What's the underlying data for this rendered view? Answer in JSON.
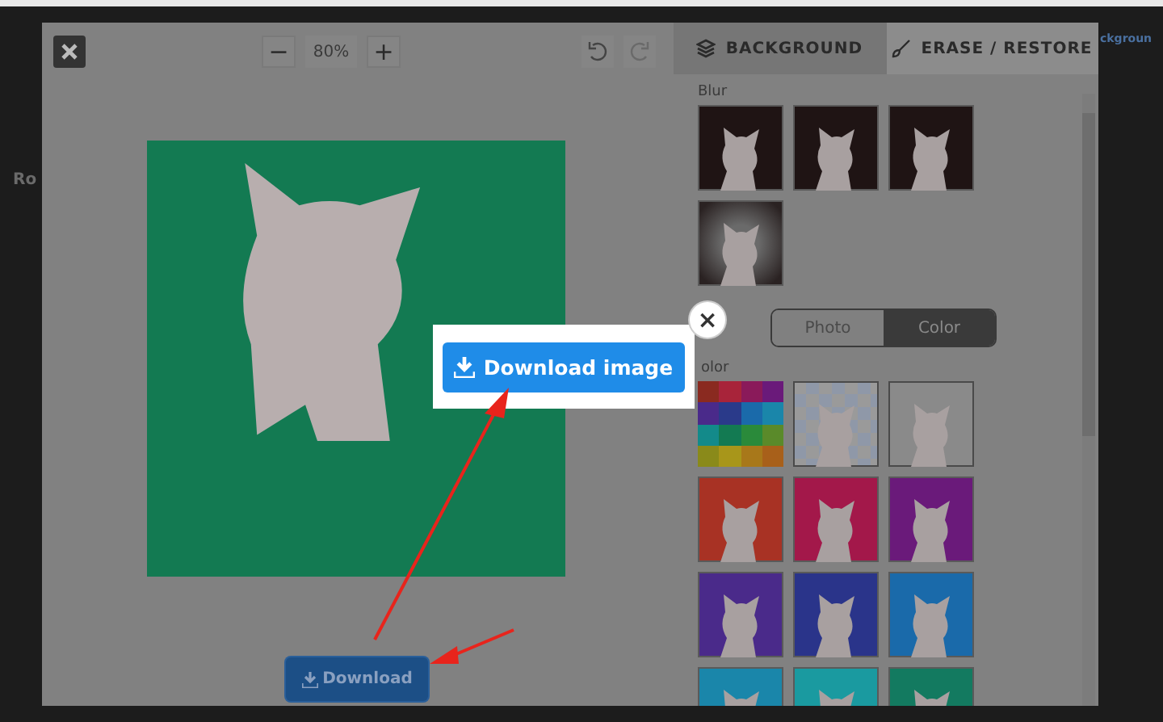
{
  "page_behind": {
    "left_text": "Ro",
    "right_text": "ckgroun"
  },
  "editor": {
    "zoom_out": "−",
    "zoom": "80%",
    "zoom_in": "+",
    "download": "Download"
  },
  "tabs": [
    {
      "label": "BACKGROUND",
      "selected": true
    },
    {
      "label": "ERASE / RESTORE",
      "selected": false
    }
  ],
  "blur": {
    "label": "Blur",
    "thumbnails": [
      {
        "kind": "dark"
      },
      {
        "kind": "dark"
      },
      {
        "kind": "dark"
      },
      {
        "kind": "vignette"
      }
    ]
  },
  "mode_toggle": [
    {
      "label": "Photo",
      "selected": false
    },
    {
      "label": "Color",
      "selected": true
    }
  ],
  "color": {
    "label": "olor",
    "swatches": [
      {
        "kind": "palette"
      },
      {
        "kind": "transparent"
      },
      {
        "kind": "plain"
      },
      {
        "kind": "color",
        "color": "#a83224"
      },
      {
        "kind": "color",
        "color": "#a3184a"
      },
      {
        "kind": "color",
        "color": "#6a1a7a"
      },
      {
        "kind": "color",
        "color": "#4a2a8a"
      },
      {
        "kind": "color",
        "color": "#2a348a"
      },
      {
        "kind": "color",
        "color": "#1a6aaa"
      },
      {
        "kind": "color",
        "color": "#1a86aa"
      },
      {
        "kind": "color",
        "color": "#1a9aa0"
      },
      {
        "kind": "color",
        "color": "#137a60"
      }
    ]
  },
  "popup": {
    "close": "×",
    "button": "Download image"
  }
}
